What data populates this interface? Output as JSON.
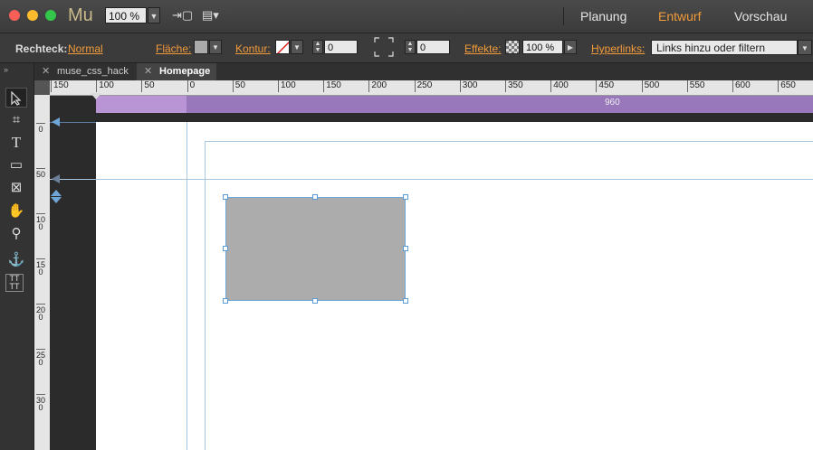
{
  "app": {
    "logo": "Mu",
    "zoom": "100 %"
  },
  "modes": [
    "Planung",
    "Entwurf",
    "Vorschau"
  ],
  "active_mode": "Entwurf",
  "controlbar": {
    "object_label": "Rechteck:",
    "object_style": "Normal",
    "fill_label": "Fläche:",
    "stroke_label": "Kontur:",
    "stroke_value": "0",
    "corner_value": "0",
    "effects_label": "Effekte:",
    "effects_value": "100 %",
    "hyperlinks_label": "Hyperlinks:",
    "hyperlinks_value": "Links hinzu oder filtern"
  },
  "tabs": [
    {
      "label": "muse_css_hack",
      "active": false
    },
    {
      "label": "Homepage",
      "active": true
    }
  ],
  "tools": [
    "selection-tool",
    "crop-tool",
    "text-tool",
    "rectangle-tool",
    "frame-tool",
    "hand-tool",
    "zoom-tool",
    "anchor-tool",
    "text-frame-tool"
  ],
  "ruler_h": [
    "150",
    "100",
    "50",
    "0",
    "50",
    "100",
    "150",
    "200",
    "250",
    "300",
    "350",
    "400",
    "450",
    "500",
    "550",
    "600",
    "650"
  ],
  "ruler_v": [
    "0",
    "50",
    "100",
    "150",
    "200",
    "250",
    "300"
  ],
  "breakpoint": {
    "label": "960"
  },
  "colors": {
    "accent": "#f29b3a",
    "breakpoint": "#9877bb",
    "shape_fill": "#acacac",
    "selection": "#5a9bd5"
  }
}
